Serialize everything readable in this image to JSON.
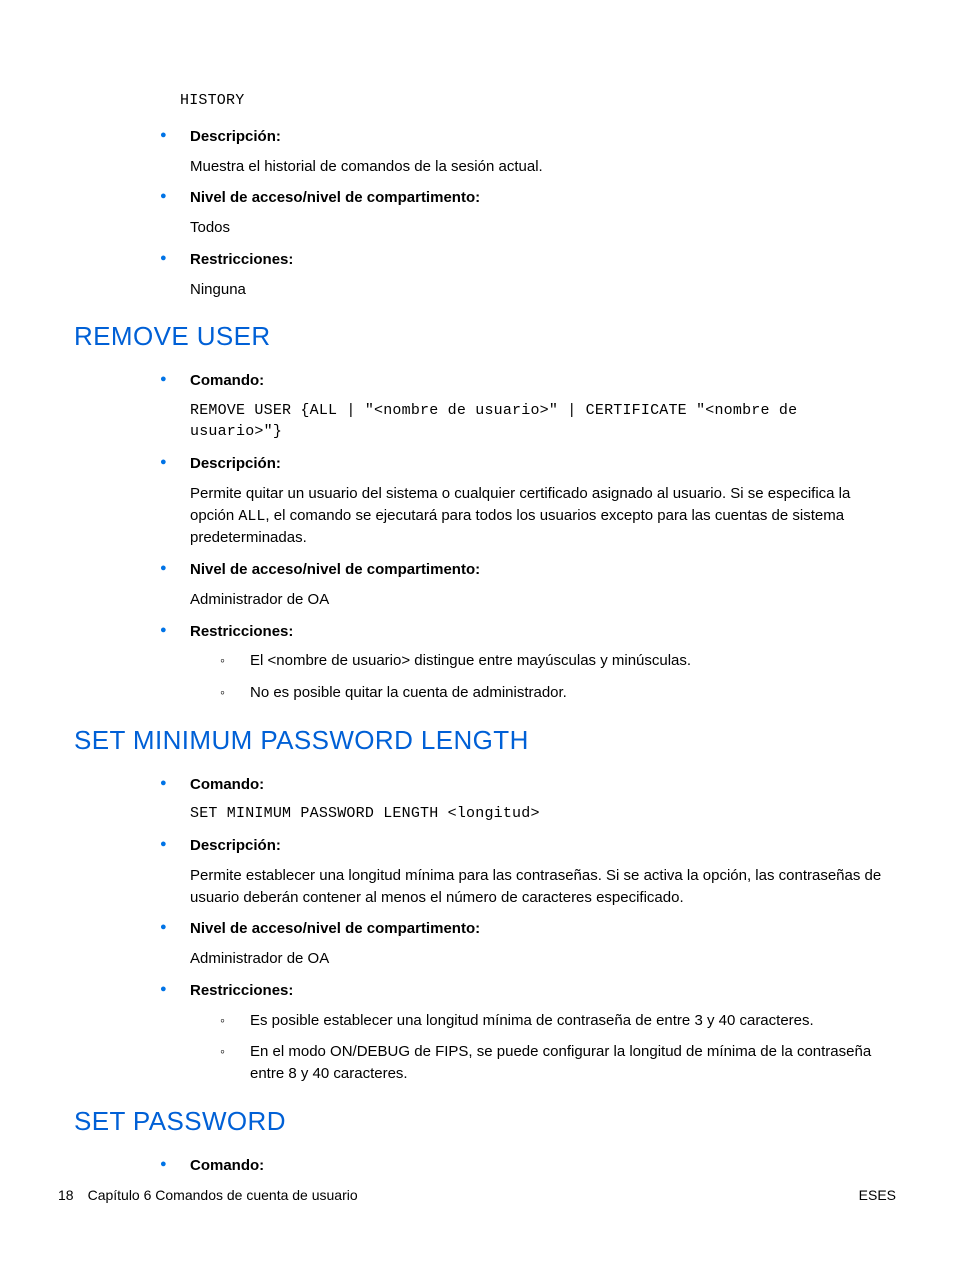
{
  "section0": {
    "code_pre": "HISTORY",
    "items": [
      {
        "label": "Descripción:",
        "body": [
          "Muestra el historial de comandos de la sesión actual."
        ]
      },
      {
        "label": "Nivel de acceso/nivel de compartimento:",
        "body": [
          "Todos"
        ]
      },
      {
        "label": "Restricciones:",
        "body": [
          "Ninguna"
        ]
      }
    ]
  },
  "section1": {
    "heading": "REMOVE USER",
    "items": [
      {
        "label": "Comando:",
        "code": "REMOVE USER {ALL | \"<nombre de usuario>\" | CERTIFICATE \"<nombre de usuario>\"}"
      },
      {
        "label": "Descripción:",
        "body_parts": {
          "p1": "Permite quitar un usuario del sistema o cualquier certificado asignado al usuario. Si se especifica la opción ",
          "code": "ALL",
          "p2": ", el comando se ejecutará para todos los usuarios excepto para las cuentas de sistema predeterminadas."
        }
      },
      {
        "label": "Nivel de acceso/nivel de compartimento:",
        "body": [
          "Administrador de OA"
        ]
      },
      {
        "label": "Restricciones:",
        "sub": [
          "El <nombre de usuario> distingue entre mayúsculas y minúsculas.",
          "No es posible quitar la cuenta de administrador."
        ]
      }
    ]
  },
  "section2": {
    "heading": "SET MINIMUM PASSWORD LENGTH",
    "items": [
      {
        "label": "Comando:",
        "code": "SET MINIMUM PASSWORD LENGTH <longitud>"
      },
      {
        "label": "Descripción:",
        "body": [
          "Permite establecer una longitud mínima para las contraseñas. Si se activa la opción, las contraseñas de usuario deberán contener al menos el número de caracteres especificado."
        ]
      },
      {
        "label": "Nivel de acceso/nivel de compartimento:",
        "body": [
          "Administrador de OA"
        ]
      },
      {
        "label": "Restricciones:",
        "sub": [
          "Es posible establecer una longitud mínima de contraseña de entre 3 y 40 caracteres.",
          "En el modo ON/DEBUG de FIPS, se puede configurar la longitud de mínima de la contraseña entre 8 y 40 caracteres."
        ]
      }
    ]
  },
  "section3": {
    "heading": "SET PASSWORD",
    "items": [
      {
        "label": "Comando:"
      }
    ]
  },
  "footer": {
    "page_number": "18",
    "chapter": "Capítulo 6   Comandos de cuenta de usuario",
    "lang": "ESES"
  }
}
